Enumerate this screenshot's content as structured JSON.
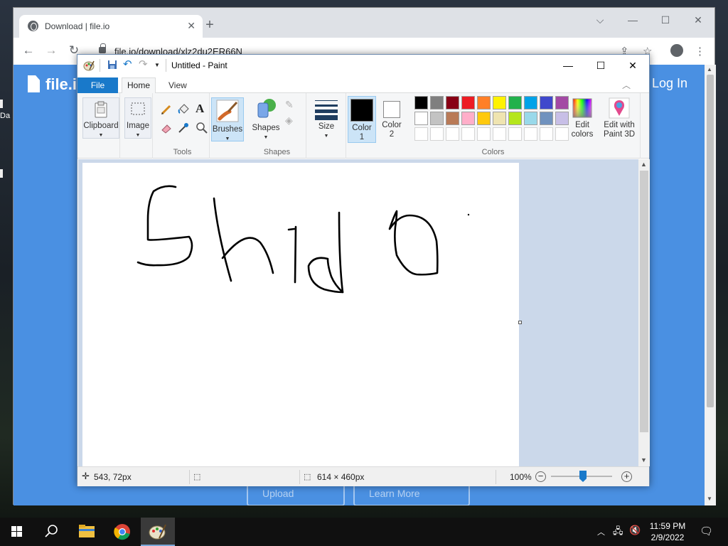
{
  "desktop": {
    "peek_labels": [
      "Da"
    ]
  },
  "browser": {
    "tab_title": "Download | file.io",
    "tab_close": "✕",
    "new_tab": "+",
    "window_buttons": {
      "dropdown": "⌵",
      "minimize": "—",
      "maximize": "☐",
      "close": "✕"
    },
    "nav": {
      "back": "←",
      "forward": "→",
      "reload": "↻"
    },
    "url": "file.io/download/xlz2du2ER66N",
    "toolbar_icons": [
      "share-icon",
      "star-icon",
      "profile-icon",
      "menu-icon"
    ],
    "share": "⇪",
    "star": "☆",
    "menu": "⋮"
  },
  "site": {
    "logo": "file.io",
    "help": "?",
    "login": "Log In",
    "buttons": [
      "Upload",
      "Learn More"
    ],
    "bg_color": "#4a90e2"
  },
  "paint": {
    "title": "Untitled - Paint",
    "window_buttons": {
      "minimize": "—",
      "maximize": "☐",
      "close": "✕"
    },
    "tabs": {
      "file": "File",
      "home": "Home",
      "view": "View"
    },
    "groups": {
      "clipboard": "Clipboard",
      "image": "Image",
      "tools": "Tools",
      "brushes": "Brushes",
      "shapes": "Shapes",
      "shapes_group": "Shapes",
      "size": "Size",
      "colors": "Colors"
    },
    "color1_label": "Color\n1",
    "color1_line1": "Color",
    "color1_line2": "1",
    "color2_line1": "Color",
    "color2_line2": "2",
    "edit_colors_line1": "Edit",
    "edit_colors_line2": "colors",
    "paint3d_line1": "Edit with",
    "paint3d_line2": "Paint 3D",
    "color1": "#000000",
    "color2": "#ffffff",
    "palette_row1": [
      "#000000",
      "#7f7f7f",
      "#880015",
      "#ed1c24",
      "#ff7f27",
      "#fff200",
      "#22b14c",
      "#00a2e8",
      "#3f48cc",
      "#a349a4"
    ],
    "palette_row2": [
      "#ffffff",
      "#c3c3c3",
      "#b97a57",
      "#ffaec9",
      "#ffc90e",
      "#efe4b0",
      "#b5e61d",
      "#99d9ea",
      "#7092be",
      "#c8bfe7"
    ],
    "status": {
      "cursor": "543, 72px",
      "canvas_size": "614 × 460px",
      "zoom": "100%",
      "zoom_level_percent": 100
    }
  },
  "taskbar": {
    "clock_time": "11:59 PM",
    "clock_date": "2/9/2022"
  }
}
